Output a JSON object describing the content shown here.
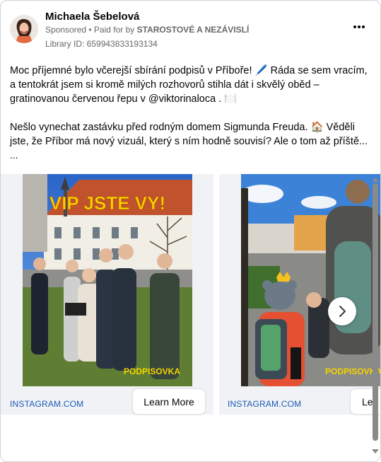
{
  "post": {
    "author": "Michaela Šebelová",
    "sponsored": "Sponsored",
    "paid_for": " • Paid for by ",
    "sponsor": "STAROSTOVÉ A NEZÁVISLÍ",
    "library_id": "Library ID: 659943833193134",
    "paragraph1": "Moc příjemné bylo včerejší sbírání podpisů v Příboře! 🖊️ Ráda se sem vracím, a tentokrát jsem si kromě milých rozhovorů stihla dát i skvělý oběd – gratinovanou červenou řepu v @viktorinaloca . 🍽️",
    "paragraph2": "Nešlo vynechat zastávku před rodným domem Sigmunda Freuda. 🏠 Věděli jste, že Příbor má nový vizuál, který s ním hodně souvisí? Ale o tom až příště...",
    "ellipsis": "..."
  },
  "carousel": {
    "cards": [
      {
        "overlay_title": "VIP JSTE VY!",
        "overlay_caption": "PODPISOVKA",
        "link": "INSTAGRAM.COM",
        "cta": "Learn More"
      },
      {
        "overlay_caption": "PODPISOVKA",
        "link": "INSTAGRAM.COM",
        "cta": "Le"
      }
    ]
  },
  "icons": {
    "more": "more-horizontal-icon",
    "next": "chevron-right-icon"
  },
  "colors": {
    "link": "#1c5bb6",
    "meta": "#65676b",
    "overlay_text": "#f5d400"
  }
}
